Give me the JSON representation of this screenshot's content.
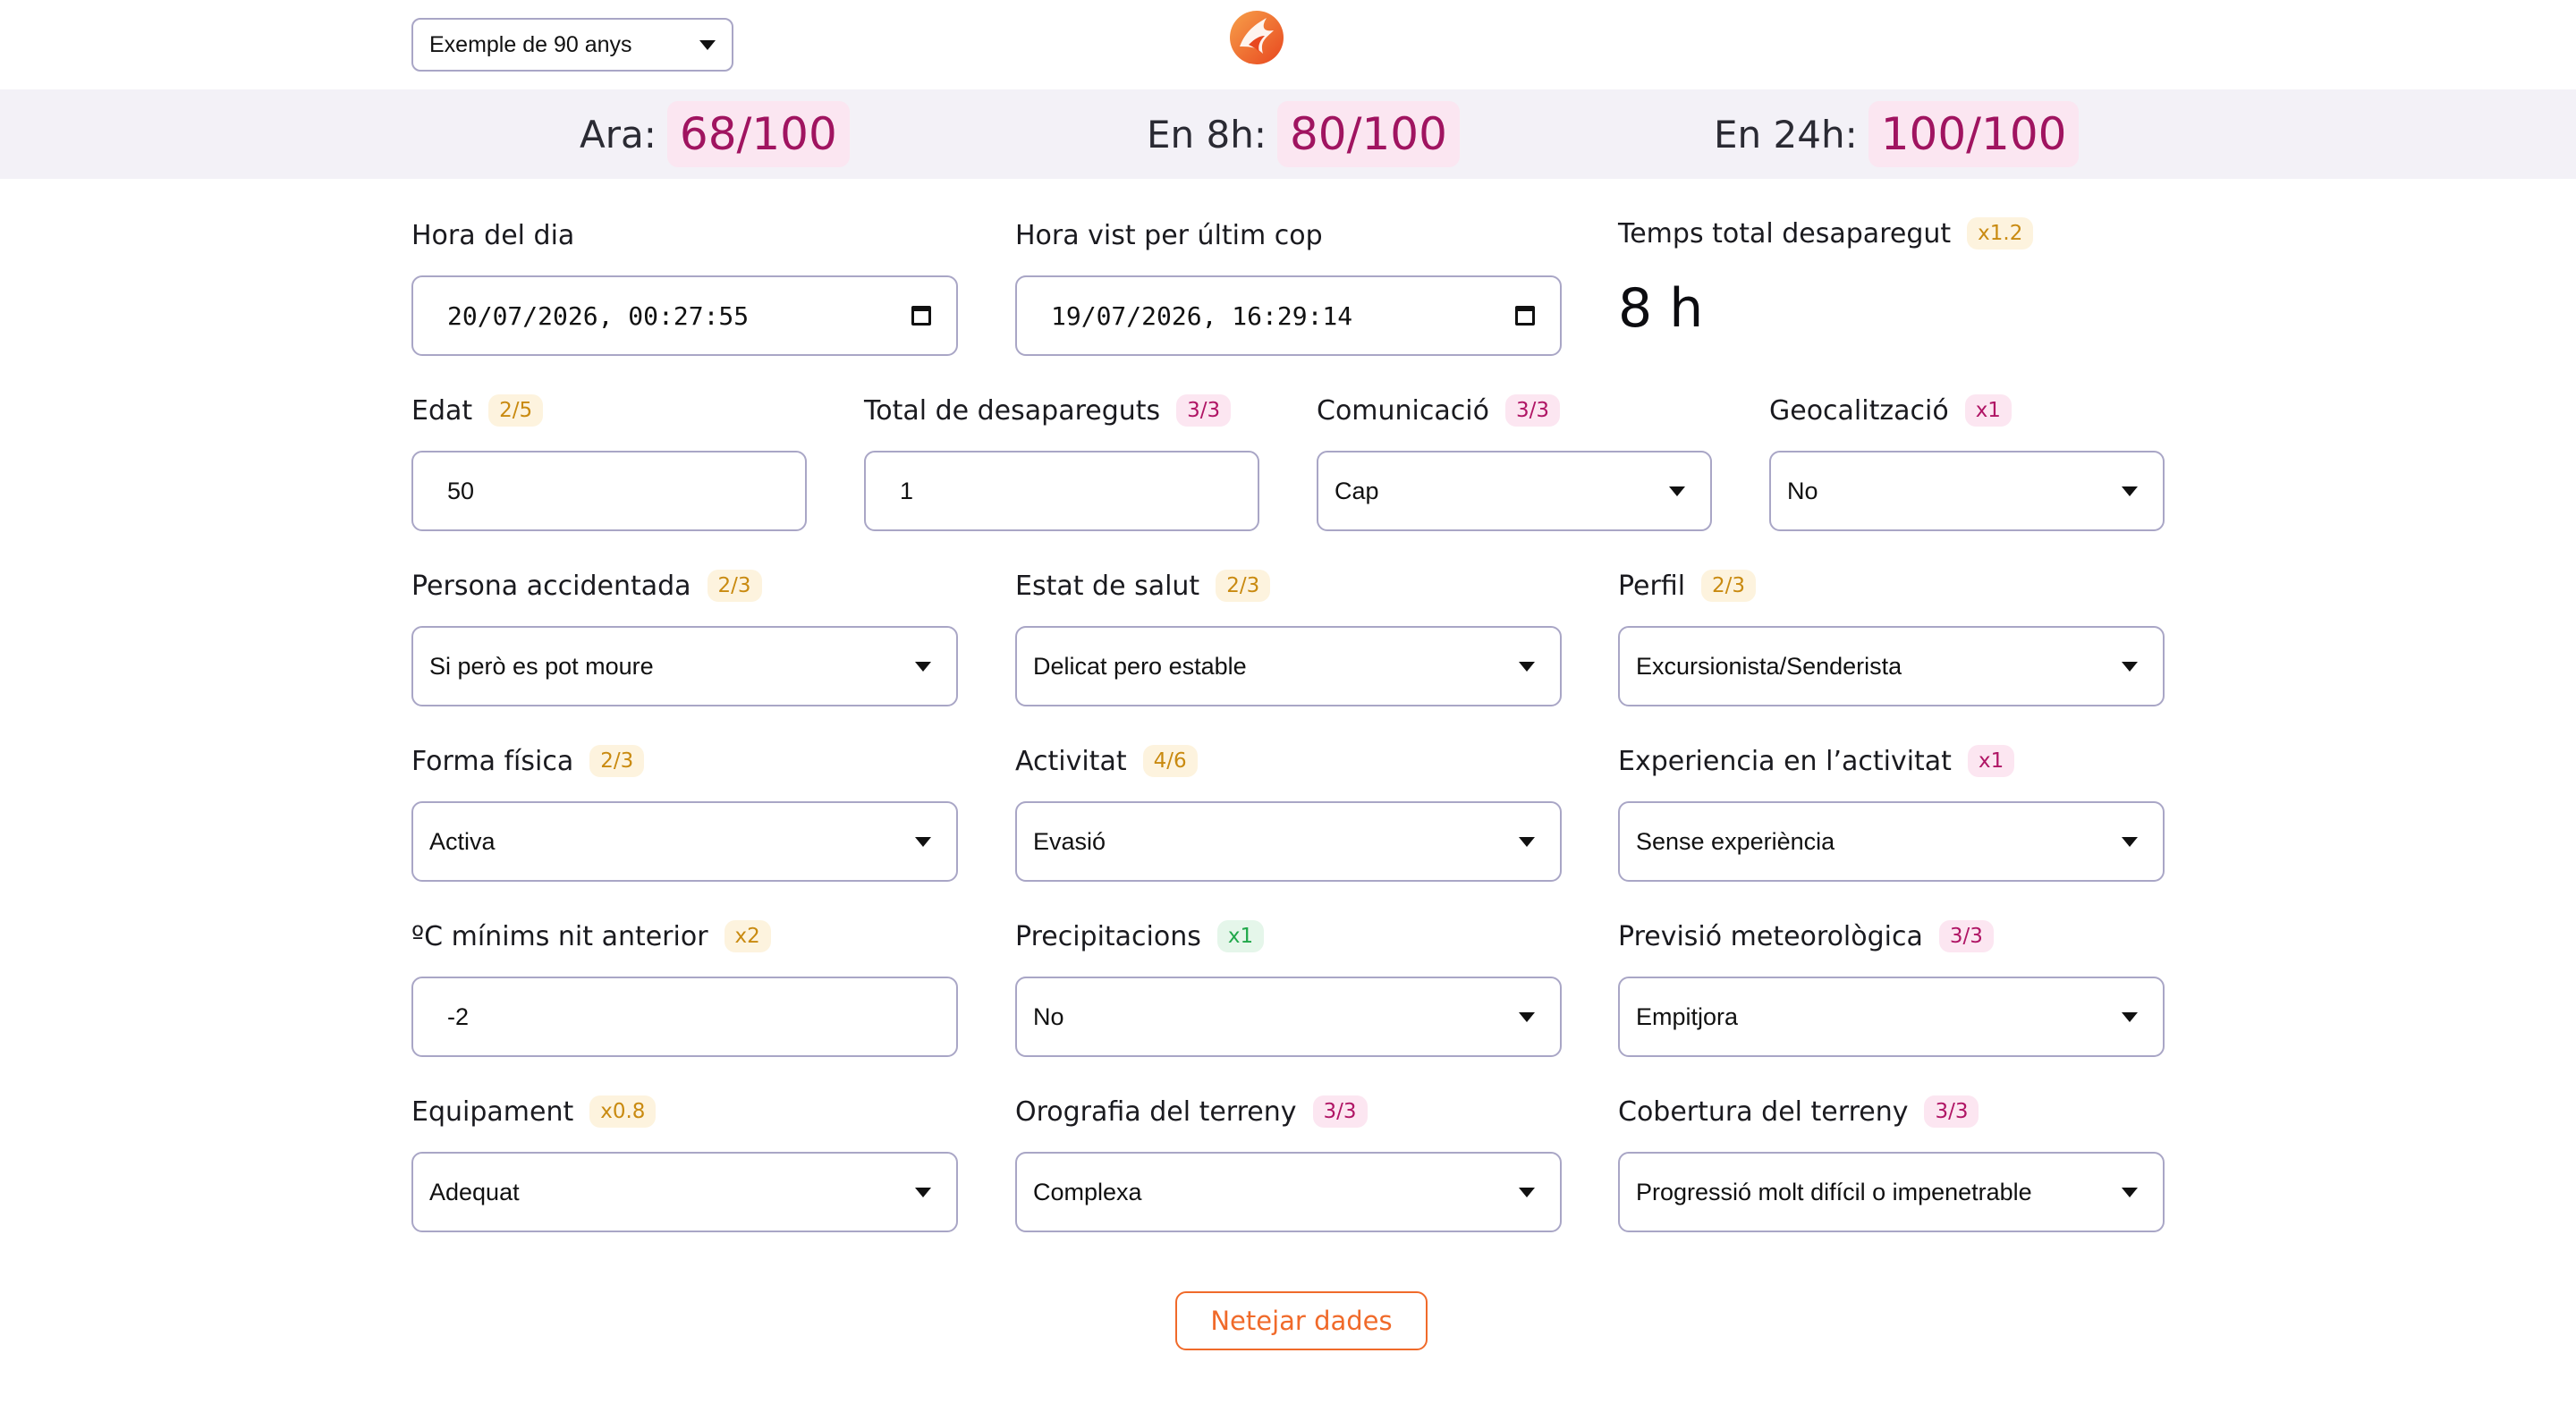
{
  "header": {
    "example_select": "Exemple de 90 anys"
  },
  "scores": {
    "now_label": "Ara:",
    "now_value": "68/100",
    "h8_label": "En 8h:",
    "h8_value": "80/100",
    "h24_label": "En 24h:",
    "h24_value": "100/100"
  },
  "row1": {
    "time_of_day": {
      "label": "Hora del dia",
      "value": "20/07/2026, 00:27:55"
    },
    "last_seen": {
      "label": "Hora vist per últim cop",
      "value": "19/07/2026, 16:29:14"
    },
    "total_missing": {
      "label": "Temps total desaparegut",
      "badge": "x1.2",
      "value": "8 h"
    }
  },
  "row2": {
    "age": {
      "label": "Edat",
      "badge": "2/5",
      "value": "50"
    },
    "total_people": {
      "label": "Total de desapareguts",
      "badge": "3/3",
      "value": "1"
    },
    "communication": {
      "label": "Comunicació",
      "badge": "3/3",
      "value": "Cap"
    },
    "geolocation": {
      "label": "Geocalització",
      "badge": "x1",
      "value": "No"
    }
  },
  "row3": {
    "injured": {
      "label": "Persona accidentada",
      "badge": "2/3",
      "value": "Si però es pot moure"
    },
    "health": {
      "label": "Estat de salut",
      "badge": "2/3",
      "value": "Delicat pero estable"
    },
    "profile": {
      "label": "Perfil",
      "badge": "2/3",
      "value": "Excursionista/Senderista"
    }
  },
  "row4": {
    "fitness": {
      "label": "Forma física",
      "badge": "2/3",
      "value": "Activa"
    },
    "activity": {
      "label": "Activitat",
      "badge": "4/6",
      "value": "Evasió"
    },
    "experience": {
      "label": "Experiencia en l’activitat",
      "badge": "x1",
      "value": "Sense experiència"
    }
  },
  "row5": {
    "min_temp": {
      "label": "ºC mínims nit anterior",
      "badge": "x2",
      "value": "-2"
    },
    "precipitation": {
      "label": "Precipitacions",
      "badge": "x1",
      "value": "No"
    },
    "forecast": {
      "label": "Previsió meteorològica",
      "badge": "3/3",
      "value": "Empitjora"
    }
  },
  "row6": {
    "equipment": {
      "label": "Equipament",
      "badge": "x0.8",
      "value": "Adequat"
    },
    "orography": {
      "label": "Orografia del terreny",
      "badge": "3/3",
      "value": "Complexa"
    },
    "cover": {
      "label": "Cobertura del terreny",
      "badge": "3/3",
      "value": "Progressió molt difícil o impenetrable"
    }
  },
  "actions": {
    "clear_label": "Netejar dades"
  },
  "colors": {
    "score_text": "#a01460",
    "score_bg": "#fbe6f1",
    "band_bg": "#f3f1f7",
    "badge_orange": "#c98a10",
    "badge_pink": "#b01565",
    "badge_green": "#20a84a",
    "accent": "#f06a2a",
    "control_border": "#a9a6c6"
  },
  "icons": {
    "logo": "phoenix-logo-icon",
    "calendar": "calendar-icon",
    "dropdown": "caret-down-icon"
  }
}
